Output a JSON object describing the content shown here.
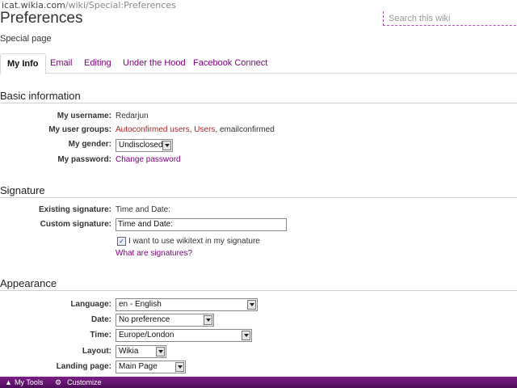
{
  "browser": {
    "url_main": "icat.wikia.com",
    "url_rest": "/wiki/Special:Preferences"
  },
  "header": {
    "title": "Preferences",
    "subtitle": "Special page",
    "search_placeholder": "Search this wiki"
  },
  "tabs": [
    {
      "label": "My Info",
      "active": true
    },
    {
      "label": "Email"
    },
    {
      "label": "Editing"
    },
    {
      "label": "Under the Hood"
    },
    {
      "label": "Facebook Connect"
    }
  ],
  "basic": {
    "heading": "Basic information",
    "username_label": "My username:",
    "username": "Redarjun",
    "groups_label": "My user groups:",
    "group1": "Autoconfirmed users",
    "group2": "Users",
    "group3": "emailconfirmed",
    "gender_label": "My gender:",
    "gender": "Undisclosed",
    "password_label": "My password:",
    "password_link": "Change password"
  },
  "signature": {
    "heading": "Signature",
    "existing_label": "Existing signature:",
    "existing": "Time and Date:",
    "custom_label": "Custom signature:",
    "custom_value": "Time and Date:",
    "wikitext_checkbox": "I want to use wikitext in my signature",
    "wikitext_checked": true,
    "help_link": "What are signatures?"
  },
  "appearance": {
    "heading": "Appearance",
    "language_label": "Language:",
    "language": "en - English",
    "date_label": "Date:",
    "date": "No preference",
    "time_label": "Time:",
    "time": "Europe/London",
    "layout_label": "Layout:",
    "layout": "Wikia",
    "landing_label": "Landing page:",
    "landing": "Main Page"
  },
  "toolbar": {
    "mytools": "My Tools",
    "customize": "Customize"
  }
}
